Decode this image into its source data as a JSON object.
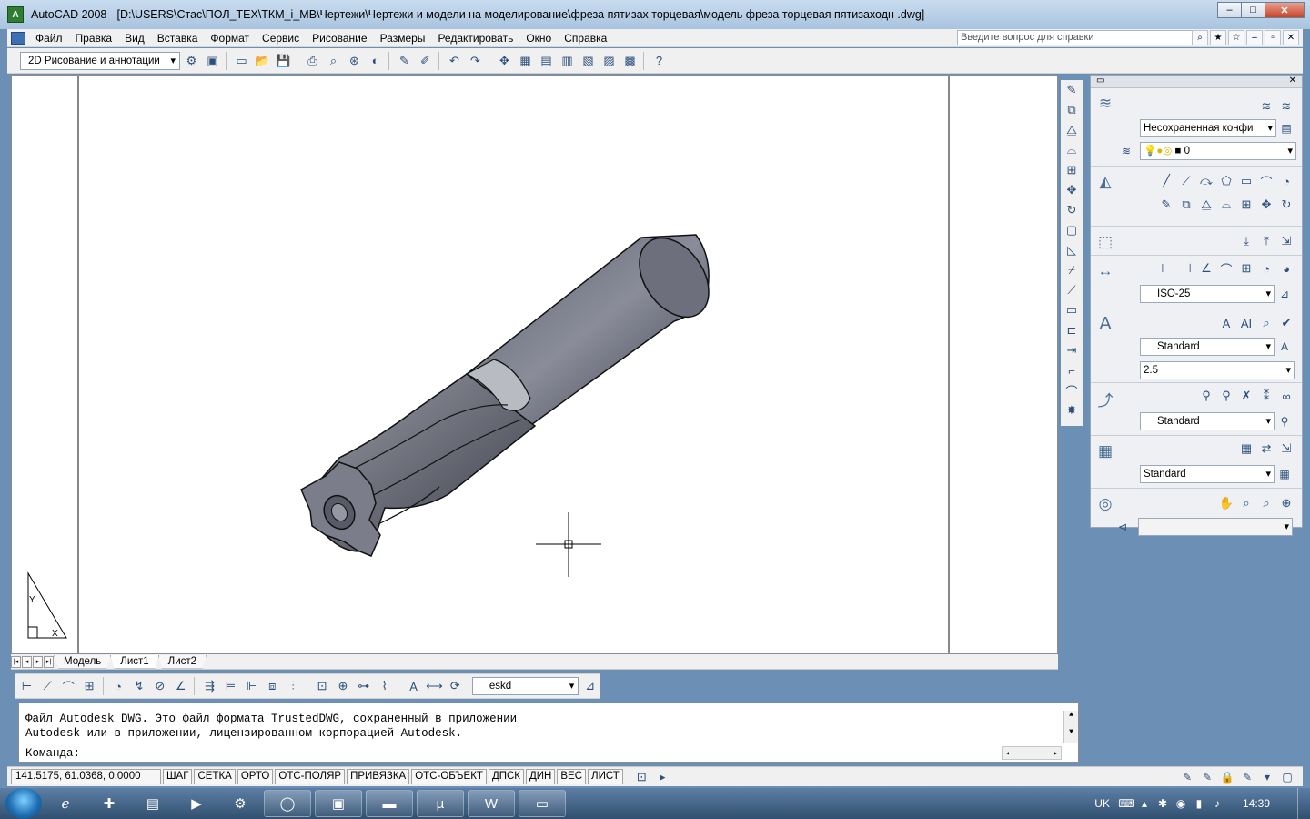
{
  "window": {
    "title": "AutoCAD 2008 - [D:\\USERS\\Стас\\ПОЛ_ТЕХ\\ТКМ_i_МВ\\Чертежи\\Чертежи и модели на моделирование\\фреза пятизах торцевая\\модель фреза торцевая пятизаходн .dwg]",
    "app_icon_label": "A",
    "minimize": "–",
    "maximize": "□",
    "close": "✕"
  },
  "menu": {
    "items": [
      "Файл",
      "Правка",
      "Вид",
      "Вставка",
      "Формат",
      "Сервис",
      "Рисование",
      "Размеры",
      "Редактировать",
      "Окно",
      "Справка"
    ],
    "help_placeholder": "Введите вопрос для справки"
  },
  "toolbar": {
    "workspace": "2D Рисование и аннотации"
  },
  "palette": {
    "layer_state": "Несохраненная конфи",
    "layer_name": "0",
    "dim_style": "ISO-25",
    "text_style": "Standard",
    "text_height": "2.5",
    "mleader_style": "Standard",
    "table_style": "Standard"
  },
  "tabs": [
    "Модель",
    "Лист1",
    "Лист2"
  ],
  "dim_toolbar": {
    "style": "eskd"
  },
  "command": {
    "line1": "Файл Autodesk DWG. Это файл формата TrustedDWG, сохраненный в приложении",
    "line2": "Autodesk или в приложении, лицензированном корпорацией Autodesk.",
    "prompt": "Команда:"
  },
  "status": {
    "coords": "141.5175, 61.0368, 0.0000",
    "buttons": [
      "ШАГ",
      "СЕТКА",
      "ОРТО",
      "ОТС-ПОЛЯР",
      "ПРИВЯЗКА",
      "ОТС-ОБЪЕКТ",
      "ДПСК",
      "ДИН",
      "ВЕС",
      "ЛИСТ"
    ]
  },
  "taskbar": {
    "lang": "UK",
    "time": "14:39"
  },
  "ucs": {
    "x_label": "X",
    "y_label": "Y"
  }
}
